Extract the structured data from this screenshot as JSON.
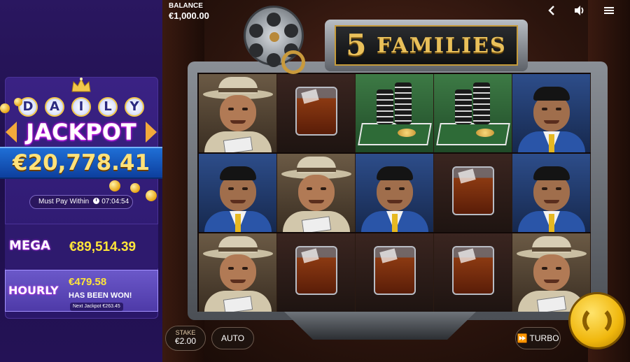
{
  "jackpot": {
    "daily_letters": [
      "D",
      "A",
      "I",
      "L",
      "Y"
    ],
    "jackpot_word": "JACKPOT",
    "daily_amount": "€20,778.41",
    "must_pay_label": "Must Pay Within",
    "must_pay_time": "07:04:54",
    "mega_label": "MEGA",
    "mega_amount": "€89,514.39",
    "hourly_label": "HOURLY",
    "hourly_amount": "€479.58",
    "hourly_status": "HAS BEEN WON!",
    "next_jackpot": "Next Jackpot €263.45"
  },
  "header": {
    "balance_label": "BALANCE",
    "balance_value": "€1,000.00",
    "icons": [
      "back-icon",
      "volume-icon",
      "menu-icon"
    ]
  },
  "game": {
    "title_number": "5",
    "title_word": "FAMILIES",
    "reels": [
      [
        "mobster-hat",
        "mobster-hair",
        "mobster-hat"
      ],
      [
        "whisky",
        "mobster-hat",
        "whisky"
      ],
      [
        "chips",
        "mobster-hair",
        "whisky"
      ],
      [
        "chips",
        "whisky",
        "whisky"
      ],
      [
        "mobster-hair",
        "mobster-hair",
        "mobster-hat"
      ]
    ]
  },
  "controls": {
    "stake_label": "STAKE",
    "stake_value": "€2.00",
    "auto_label": "AUTO",
    "turbo_label": "TURBO",
    "turbo_icon": "fast-forward-icon",
    "spin_icon": "spin-icon"
  },
  "colors": {
    "jackpot_panel": "#2a1760",
    "jackpot_amount": "#ffe27a",
    "mega_amount": "#ffe53a",
    "spin_button": "#f0b70d",
    "title_gold": "#e9c05a"
  }
}
